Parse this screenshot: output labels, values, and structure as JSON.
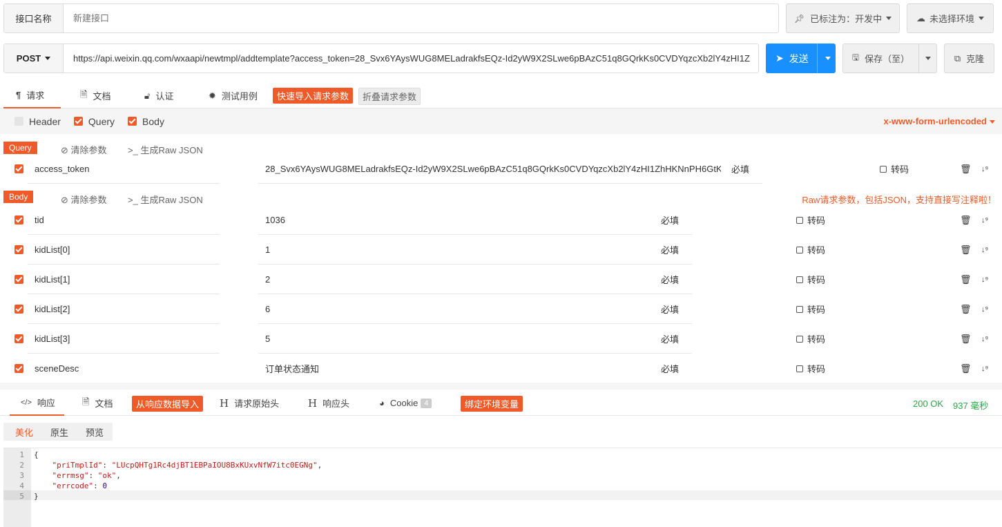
{
  "top": {
    "name_label": "接口名称",
    "name_placeholder": "新建接口",
    "tag_label": "已标注为：开发中",
    "env_label": "未选择环境"
  },
  "request": {
    "method": "POST",
    "url": "https://api.weixin.qq.com/wxaapi/newtmpl/addtemplate?access_token=28_Svx6YAysWUG8MELadrakfsEQz-Id2yW9X2SLwe6pBAzC51q8GQrkKs0CVDYqzcXb2lY4zHI1Z",
    "send": "发送",
    "save": "保存（至）",
    "clone": "克隆"
  },
  "req_tabs": {
    "request": "请求",
    "docs": "文档",
    "auth": "认证",
    "tests": "测试用例",
    "import": "快速导入请求参数",
    "fold": "折叠请求参数"
  },
  "filters": {
    "header": "Header",
    "query": "Query",
    "body": "Body",
    "content_type": "x-www-form-urlencoded"
  },
  "query_section": {
    "tag": "Query",
    "clear": "清除参数",
    "raw": "生成Raw JSON"
  },
  "query_params": [
    {
      "key": "access_token",
      "value": "28_Svx6YAysWUG8MELadrakfsEQz-Id2yW9X2SLwe6pBAzC51q8GQrkKs0CVDYqzcXb2lY4zHI1ZhHKNnPH6GtK",
      "required": "必填",
      "encode": "转码"
    }
  ],
  "body_section": {
    "tag": "Body",
    "clear": "清除参数",
    "raw": "生成Raw JSON",
    "hint": "Raw请求参数，包括JSON，支持直接写注释啦！"
  },
  "body_params": [
    {
      "key": "tid",
      "value": "1036",
      "required": "必填",
      "encode": "转码"
    },
    {
      "key": "kidList[0]",
      "value": "1",
      "required": "必填",
      "encode": "转码"
    },
    {
      "key": "kidList[1]",
      "value": "2",
      "required": "必填",
      "encode": "转码"
    },
    {
      "key": "kidList[2]",
      "value": "6",
      "required": "必填",
      "encode": "转码"
    },
    {
      "key": "kidList[3]",
      "value": "5",
      "required": "必填",
      "encode": "转码"
    },
    {
      "key": "sceneDesc",
      "value": "订单状态通知",
      "required": "必填",
      "encode": "转码"
    }
  ],
  "resp_tabs": {
    "response": "响应",
    "docs": "文档",
    "import": "从响应数据导入",
    "raw_headers": "请求原始头",
    "resp_headers": "响应头",
    "cookie": "Cookie",
    "cookie_count": "4",
    "bind": "绑定环境变量"
  },
  "status": {
    "code": "200 OK",
    "time": "937 毫秒"
  },
  "view_tabs": {
    "pretty": "美化",
    "raw": "原生",
    "preview": "预览"
  },
  "code_lines": [
    {
      "num": "1",
      "text": "{"
    },
    {
      "num": "2",
      "key": "\"priTmplId\"",
      "val": "\"LUcpQHTg1Rc4djBT1EBPaIOU8BxKUxvNfW7itc0EGNg\"",
      "tail": ","
    },
    {
      "num": "3",
      "key": "\"errmsg\"",
      "val": "\"ok\"",
      "tail": ","
    },
    {
      "num": "4",
      "key": "\"errcode\"",
      "val": "0",
      "tail": ""
    },
    {
      "num": "5",
      "text": "}"
    }
  ],
  "colors": {
    "accent": "#f05a28",
    "send": "#1890ff",
    "success": "#28a745"
  }
}
